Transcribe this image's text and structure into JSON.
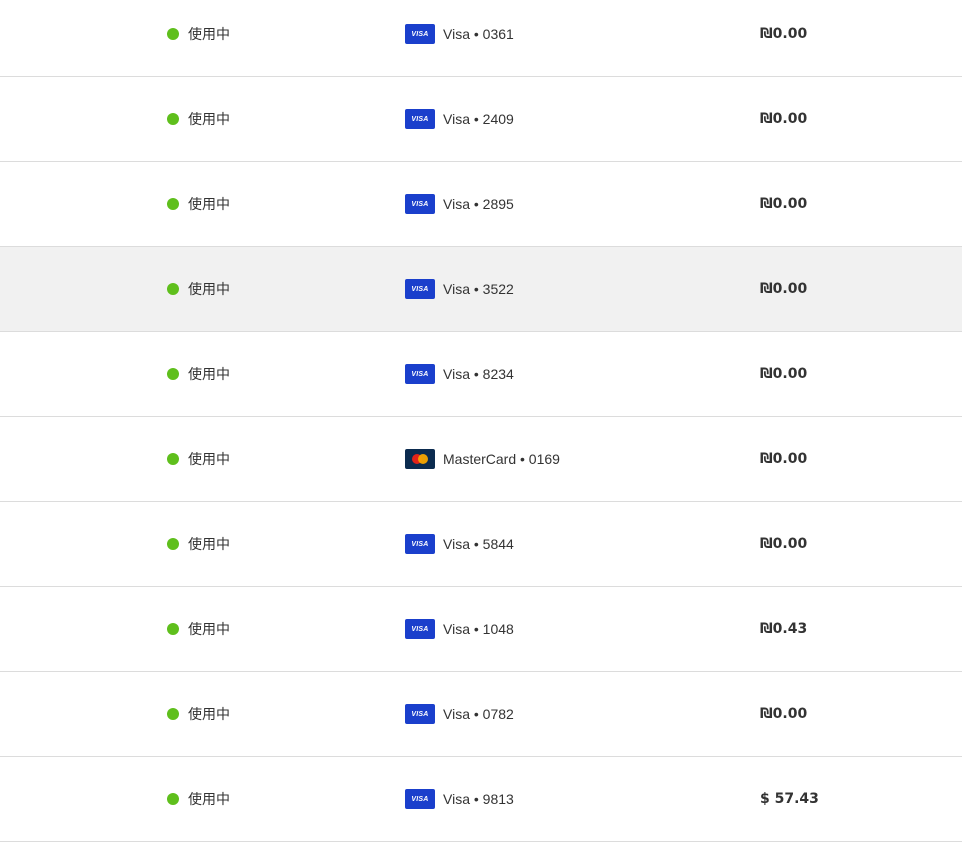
{
  "rows": [
    {
      "status": "使用中",
      "card_brand": "visa",
      "brand_badge": "VISA",
      "card_label": "Visa • 0361",
      "amount": "₪0.00",
      "highlighted": false
    },
    {
      "status": "使用中",
      "card_brand": "visa",
      "brand_badge": "VISA",
      "card_label": "Visa • 2409",
      "amount": "₪0.00",
      "highlighted": false
    },
    {
      "status": "使用中",
      "card_brand": "visa",
      "brand_badge": "VISA",
      "card_label": "Visa • 2895",
      "amount": "₪0.00",
      "highlighted": false
    },
    {
      "status": "使用中",
      "card_brand": "visa",
      "brand_badge": "VISA",
      "card_label": "Visa • 3522",
      "amount": "₪0.00",
      "highlighted": true
    },
    {
      "status": "使用中",
      "card_brand": "visa",
      "brand_badge": "VISA",
      "card_label": "Visa • 8234",
      "amount": "₪0.00",
      "highlighted": false
    },
    {
      "status": "使用中",
      "card_brand": "mastercard",
      "brand_badge": "",
      "card_label": "MasterCard • 0169",
      "amount": "₪0.00",
      "highlighted": false
    },
    {
      "status": "使用中",
      "card_brand": "visa",
      "brand_badge": "VISA",
      "card_label": "Visa • 5844",
      "amount": "₪0.00",
      "highlighted": false
    },
    {
      "status": "使用中",
      "card_brand": "visa",
      "brand_badge": "VISA",
      "card_label": "Visa • 1048",
      "amount": "₪0.43",
      "highlighted": false
    },
    {
      "status": "使用中",
      "card_brand": "visa",
      "brand_badge": "VISA",
      "card_label": "Visa • 0782",
      "amount": "₪0.00",
      "highlighted": false
    },
    {
      "status": "使用中",
      "card_brand": "visa",
      "brand_badge": "VISA",
      "card_label": "Visa • 9813",
      "amount": "$ 57.43",
      "highlighted": false
    }
  ],
  "colors": {
    "status_active": "#5fbf1c",
    "visa_blue": "#1a3fcc",
    "mastercard_navy": "#0b2b4f",
    "row_highlight": "#f1f1f1",
    "divider": "#dcdcdc"
  }
}
